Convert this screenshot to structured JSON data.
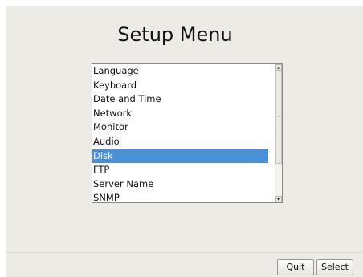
{
  "title": "Setup Menu",
  "menu": {
    "items": [
      "Language",
      "Keyboard",
      "Date and Time",
      "Network",
      "Monitor",
      "Audio",
      "Disk",
      "FTP",
      "Server Name",
      "SNMP"
    ],
    "selected_index": 6
  },
  "buttons": {
    "quit_label": "Quit",
    "select_label": "Select"
  },
  "colors": {
    "window_bg": "#edebe6",
    "selection_bg": "#4a90d9",
    "selection_text": "#ffffff"
  }
}
